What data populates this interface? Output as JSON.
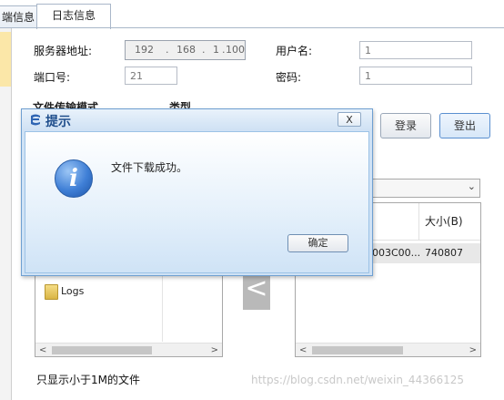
{
  "tabs": [
    {
      "label": "端信息"
    },
    {
      "label": "日志信息"
    }
  ],
  "form": {
    "server_label": "服务器地址:",
    "ip_parts": [
      "192",
      ".",
      "168",
      ".",
      "1",
      ".",
      "100"
    ],
    "port_label": "端口号:",
    "port_value": "21",
    "user_label": "用户名:",
    "user_value": "1",
    "password_label": "密码:",
    "password_value": "1"
  },
  "sections": {
    "mode_title": "文件传输模式",
    "type_title": "类型"
  },
  "buttons": {
    "login": "登录",
    "logout": "登出"
  },
  "local_files": [
    {
      "name": "Logs",
      "icon": "folder-icon"
    }
  ],
  "remote_table": {
    "columns": [
      "大小(B)"
    ],
    "rows": [
      {
        "name_partial": "003C00...",
        "size": "740807"
      }
    ]
  },
  "transfer_arrow": "<",
  "filter_label": "只显示小于1M的文件",
  "dialog": {
    "title": "提示",
    "close": "X",
    "message": "文件下载成功。",
    "ok": "确定",
    "icon": "info-icon"
  },
  "watermark": "https://blog.csdn.net/weixin_44366125",
  "colors": {
    "dialog_bg": "#cfe2f5",
    "title_text": "#1f4e8c",
    "accent_blue": "#5a8fd0"
  }
}
